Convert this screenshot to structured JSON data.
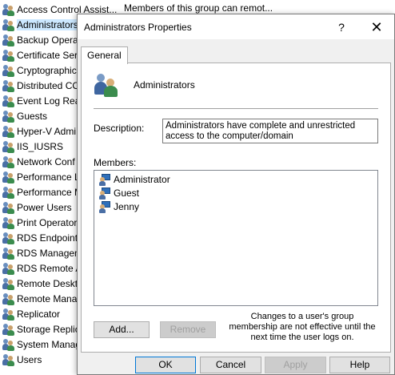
{
  "background_list": {
    "description_header": "Members of this group can remot...",
    "items": [
      {
        "name": "Access Control Assist..."
      },
      {
        "name": "Administrators"
      },
      {
        "name": "Backup Operat"
      },
      {
        "name": "Certificate Serv"
      },
      {
        "name": "Cryptographic"
      },
      {
        "name": "Distributed CO"
      },
      {
        "name": "Event Log Rea"
      },
      {
        "name": "Guests"
      },
      {
        "name": "Hyper-V Admi"
      },
      {
        "name": "IIS_IUSRS"
      },
      {
        "name": "Network Conf"
      },
      {
        "name": "Performance L"
      },
      {
        "name": "Performance M"
      },
      {
        "name": "Power Users"
      },
      {
        "name": "Print Operator"
      },
      {
        "name": "RDS Endpoint"
      },
      {
        "name": "RDS Managem"
      },
      {
        "name": "RDS Remote A"
      },
      {
        "name": "Remote Deskt"
      },
      {
        "name": "Remote Mana"
      },
      {
        "name": "Replicator"
      },
      {
        "name": "Storage Replic"
      },
      {
        "name": "System Manag"
      },
      {
        "name": "Users"
      }
    ]
  },
  "dialog": {
    "title": "Administrators Properties",
    "help_glyph": "?",
    "close_glyph": "✕",
    "tab_label": "General",
    "group_name": "Administrators",
    "description_label": "Description:",
    "description_value": "Administrators have complete and unrestricted access to the computer/domain",
    "members_label": "Members:",
    "members": [
      {
        "name": "Administrator"
      },
      {
        "name": "Guest"
      },
      {
        "name": "Jenny"
      }
    ],
    "add_label": "Add...",
    "remove_label": "Remove",
    "note": "Changes to a user's group membership are not effective until the next time the user logs on.",
    "ok_label": "OK",
    "cancel_label": "Cancel",
    "apply_label": "Apply",
    "help_label": "Help"
  },
  "colors": {
    "selection": "#cce8ff",
    "dialog_bg": "#f0f0f0",
    "default_button_border": "#0078d7"
  }
}
